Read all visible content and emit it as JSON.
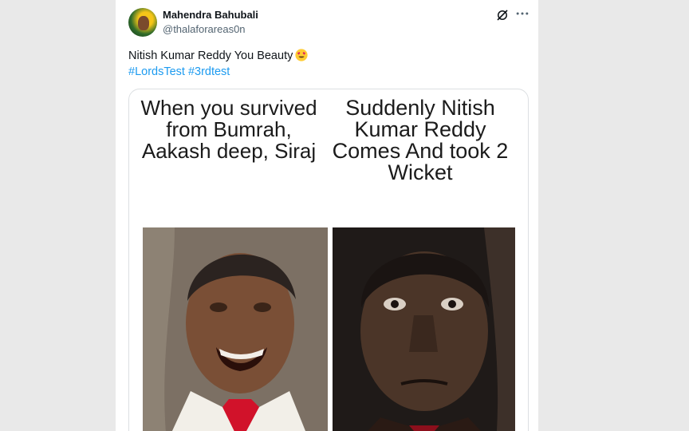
{
  "post": {
    "author_name": "Mahendra Bahubali",
    "author_handle": "@thalaforareas0n",
    "text": "Nitish Kumar Reddy You Beauty",
    "hashtags": [
      "#LordsTest",
      "#3rdtest"
    ]
  },
  "meme": {
    "left_caption": "When you survived from Bumrah, Aakash deep, Siraj",
    "right_caption": "Suddenly Nitish Kumar Reddy Comes And took 2 Wicket"
  },
  "icons": {
    "grok": "grok-icon",
    "more": "more-icon",
    "emoji": "heart-eyes-emoji-icon"
  },
  "colors": {
    "link": "#1d9bf0",
    "text": "#0f1419",
    "secondary": "#536471"
  }
}
